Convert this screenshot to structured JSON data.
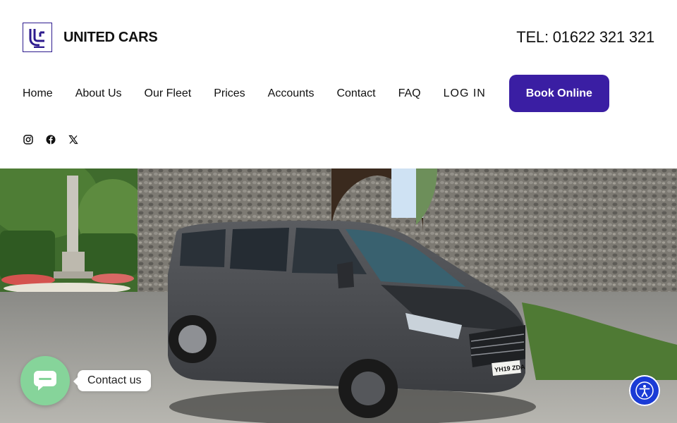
{
  "brand": {
    "name": "UNITED CARS",
    "logo_icon": "uc-monogram-icon"
  },
  "header": {
    "phone": "TEL: 01622 321 321"
  },
  "nav": {
    "items": [
      {
        "label": "Home"
      },
      {
        "label": "About Us"
      },
      {
        "label": "Our Fleet"
      },
      {
        "label": "Prices"
      },
      {
        "label": "Accounts"
      },
      {
        "label": "Contact"
      },
      {
        "label": "FAQ"
      },
      {
        "label": "LOG IN"
      }
    ],
    "book_label": "Book Online"
  },
  "social": {
    "icons": [
      "instagram-icon",
      "facebook-icon",
      "x-twitter-icon"
    ]
  },
  "hero": {
    "plate": "YH19 ZDA"
  },
  "chat": {
    "label": "Contact us",
    "icon": "chat-bubble-icon"
  },
  "accessibility": {
    "icon": "accessibility-icon"
  },
  "colors": {
    "accent": "#3a1ea3",
    "chat": "#86d49a",
    "a11y": "#1a3bd6"
  }
}
